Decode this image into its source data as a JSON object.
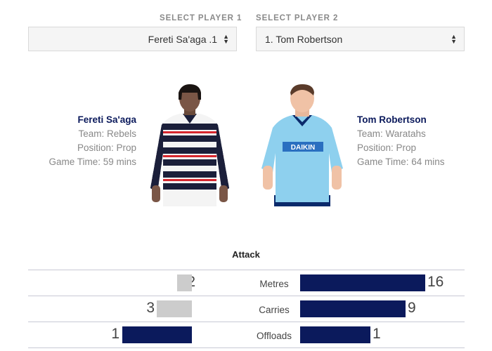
{
  "selectors": {
    "player1": {
      "label": "SELECT PLAYER 1",
      "value": "Fereti Sa'aga .1"
    },
    "player2": {
      "label": "SELECT PLAYER 2",
      "value": "1. Tom Robertson"
    }
  },
  "player1": {
    "name": "Fereti Sa'aga",
    "team": "Team: Rebels",
    "position": "Position: Prop",
    "game_time": "Game Time: 59 mins",
    "jersey_colors": [
      "#1b1f3a",
      "#ffffff",
      "#d7262e"
    ]
  },
  "player2": {
    "name": "Tom Robertson",
    "team": "Team: Waratahs",
    "position": "Position: Prop",
    "game_time": "Game Time: 64 mins",
    "jersey_colors": [
      "#8ed0ee",
      "#0b2a6b"
    ]
  },
  "section": "Attack",
  "colors": {
    "highlight": "#0b1a5c",
    "muted": "#cccccc",
    "divider": "#c8c9d4"
  },
  "stats": [
    {
      "label": "Metres",
      "player1": "2",
      "player2": "16"
    },
    {
      "label": "Carries",
      "player1": "3",
      "player2": "9"
    },
    {
      "label": "Offloads",
      "player1": "1",
      "player2": "1"
    }
  ]
}
